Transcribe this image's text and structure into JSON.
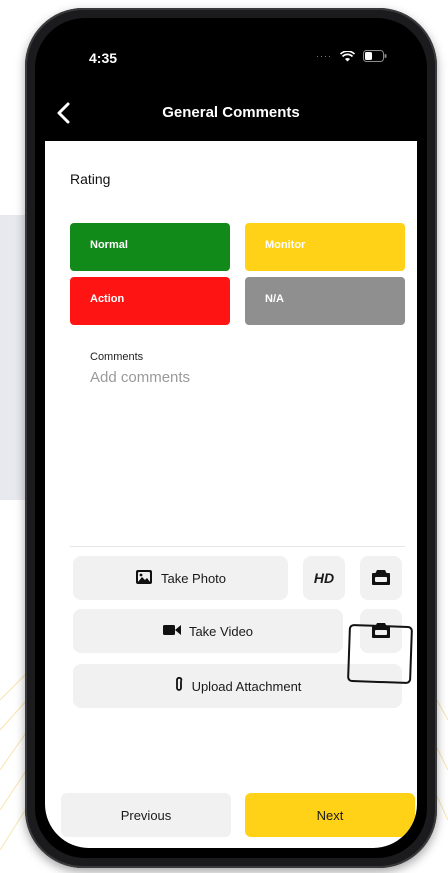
{
  "status_bar": {
    "time": "4:35"
  },
  "nav": {
    "title": "General Comments"
  },
  "rating": {
    "label": "Rating",
    "options": [
      {
        "label": "Normal",
        "color": "#118a1a"
      },
      {
        "label": "Monitor",
        "color": "#ffd218"
      },
      {
        "label": "Action",
        "color": "#ff1414"
      },
      {
        "label": "N/A",
        "color": "#8f8f8f"
      }
    ]
  },
  "comments": {
    "label": "Comments",
    "placeholder": "Add comments"
  },
  "media": {
    "take_photo": "Take Photo",
    "hd": "HD",
    "take_video": "Take Video",
    "upload_attachment": "Upload Attachment",
    "icons": [
      "photo-icon",
      "camera-switch-icon",
      "video-camera-icon",
      "paperclip-icon"
    ]
  },
  "footer": {
    "previous": "Previous",
    "next": "Next"
  },
  "colors": {
    "accent": "#ffd218",
    "button_bg": "#f1f1f2"
  }
}
